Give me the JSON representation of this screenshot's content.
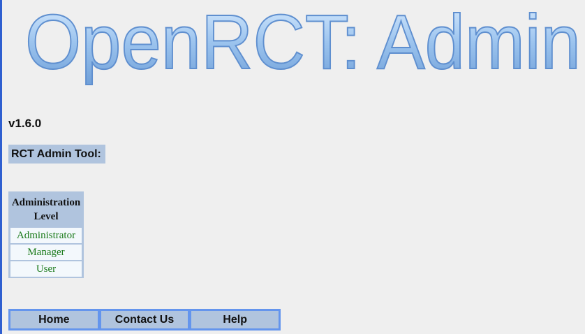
{
  "header": {
    "logo_text": "OpenRCT: Admin"
  },
  "version": "v1.6.0",
  "admin_tool_label": "RCT Admin Tool:",
  "levels": {
    "heading": "Administration Level",
    "items": [
      {
        "label": "Administrator"
      },
      {
        "label": "Manager"
      },
      {
        "label": "User"
      }
    ]
  },
  "nav": {
    "items": [
      {
        "label": "Home"
      },
      {
        "label": "Contact Us"
      },
      {
        "label": "Help"
      }
    ]
  },
  "colors": {
    "background": "#efefef",
    "panel": "#b0c4de",
    "nav_border": "#6495ed",
    "link_green": "#1a7a1a",
    "logo_fill": "#9ec6ef"
  }
}
